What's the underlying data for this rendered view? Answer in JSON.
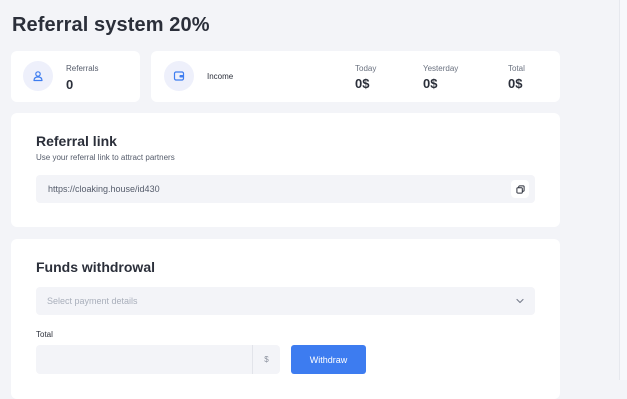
{
  "page": {
    "title": "Referral system 20%"
  },
  "stats": {
    "referrals": {
      "label": "Referrals",
      "value": "0",
      "icon": "user-icon"
    },
    "income": {
      "label": "Income",
      "icon": "wallet-icon",
      "today": {
        "label": "Today",
        "value": "0$"
      },
      "yesterday": {
        "label": "Yesterday",
        "value": "0$"
      },
      "total": {
        "label": "Total",
        "value": "0$"
      }
    }
  },
  "referral_link": {
    "title": "Referral link",
    "description": "Use your referral link to attract partners",
    "url": "https://cloaking.house/id430",
    "copy_icon": "copy-icon"
  },
  "withdrawal": {
    "title": "Funds withdrowal",
    "select_placeholder": "Select payment details",
    "total_label": "Total",
    "amount_value": "",
    "currency": "$",
    "button_label": "Withdraw"
  },
  "colors": {
    "accent": "#3d7cf0",
    "background": "#f3f4f8",
    "card": "#ffffff"
  }
}
